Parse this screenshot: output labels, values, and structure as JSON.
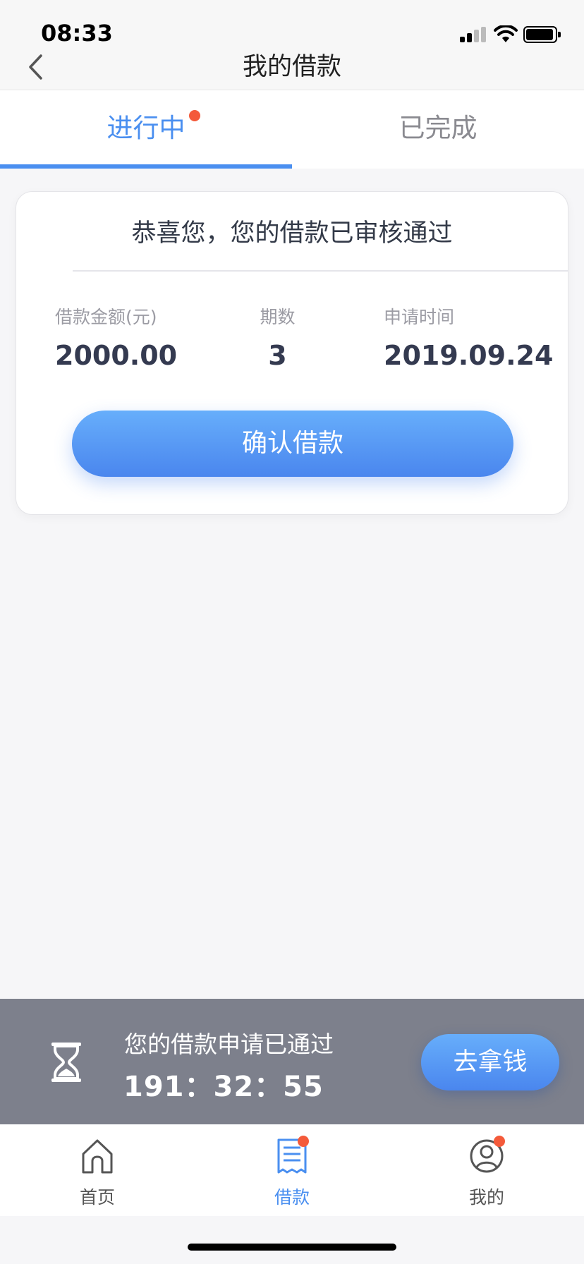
{
  "status_bar": {
    "time": "08:33"
  },
  "nav": {
    "title": "我的借款"
  },
  "tabs": [
    {
      "label": "进行中",
      "active": true,
      "badge_dot": true
    },
    {
      "label": "已完成",
      "active": false,
      "badge_dot": false
    }
  ],
  "card": {
    "title": "恭喜您，您的借款已审核通过",
    "stats": [
      {
        "label": "借款金额(元)",
        "value": "2000.00"
      },
      {
        "label": "期数",
        "value": "3"
      },
      {
        "label": "申请时间",
        "value": "2019.09.24"
      }
    ],
    "confirm_label": "确认借款"
  },
  "banner": {
    "message": "您的借款申请已通过",
    "countdown": "191：32：55",
    "action_label": "去拿钱"
  },
  "tabbar": [
    {
      "label": "首页",
      "icon": "home-icon",
      "active": false,
      "badge_dot": false
    },
    {
      "label": "借款",
      "icon": "loan-document-icon",
      "active": true,
      "badge_dot": true
    },
    {
      "label": "我的",
      "icon": "profile-icon",
      "active": false,
      "badge_dot": true
    }
  ],
  "colors": {
    "accent": "#4a8ff0",
    "badge": "#f45a3a",
    "banner_bg": "#7d808c"
  }
}
